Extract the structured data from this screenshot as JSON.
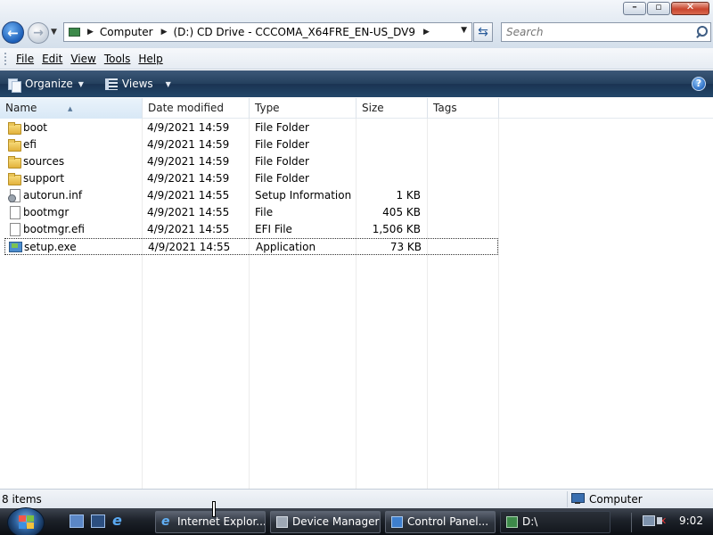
{
  "window": {
    "controls": [
      "minimize",
      "maximize",
      "close"
    ]
  },
  "address_bar": {
    "breadcrumbs": [
      "Computer",
      "(D:) CD Drive - CCCOMA_X64FRE_EN-US_DV9"
    ]
  },
  "search": {
    "placeholder": "Search"
  },
  "menu": {
    "items": [
      {
        "label": "File",
        "accel": "F"
      },
      {
        "label": "Edit",
        "accel": "E"
      },
      {
        "label": "View",
        "accel": "V"
      },
      {
        "label": "Tools",
        "accel": "T"
      },
      {
        "label": "Help",
        "accel": "H"
      }
    ]
  },
  "command_bar": {
    "organize": "Organize",
    "views": "Views"
  },
  "columns": [
    "Name",
    "Date modified",
    "Type",
    "Size",
    "Tags"
  ],
  "files": [
    {
      "name": "boot",
      "date": "4/9/2021 14:59",
      "type": "File Folder",
      "size": "",
      "icon": "folder-icon"
    },
    {
      "name": "efi",
      "date": "4/9/2021 14:59",
      "type": "File Folder",
      "size": "",
      "icon": "folder-icon"
    },
    {
      "name": "sources",
      "date": "4/9/2021 14:59",
      "type": "File Folder",
      "size": "",
      "icon": "folder-icon"
    },
    {
      "name": "support",
      "date": "4/9/2021 14:59",
      "type": "File Folder",
      "size": "",
      "icon": "folder-icon"
    },
    {
      "name": "autorun.inf",
      "date": "4/9/2021 14:55",
      "type": "Setup Information",
      "size": "1 KB",
      "icon": "setup-info-icon"
    },
    {
      "name": "bootmgr",
      "date": "4/9/2021 14:55",
      "type": "File",
      "size": "405 KB",
      "icon": "file-icon"
    },
    {
      "name": "bootmgr.efi",
      "date": "4/9/2021 14:55",
      "type": "EFI File",
      "size": "1,506 KB",
      "icon": "file-icon"
    },
    {
      "name": "setup.exe",
      "date": "4/9/2021 14:55",
      "type": "Application",
      "size": "73 KB",
      "icon": "setup-exe-icon"
    }
  ],
  "status_bar": {
    "item_count": "8 items",
    "location": "Computer"
  },
  "taskbar": {
    "tasks": [
      "Internet Explor...",
      "Device Manager",
      "Control Panel...",
      "D:\\"
    ],
    "clock": "9:02"
  }
}
